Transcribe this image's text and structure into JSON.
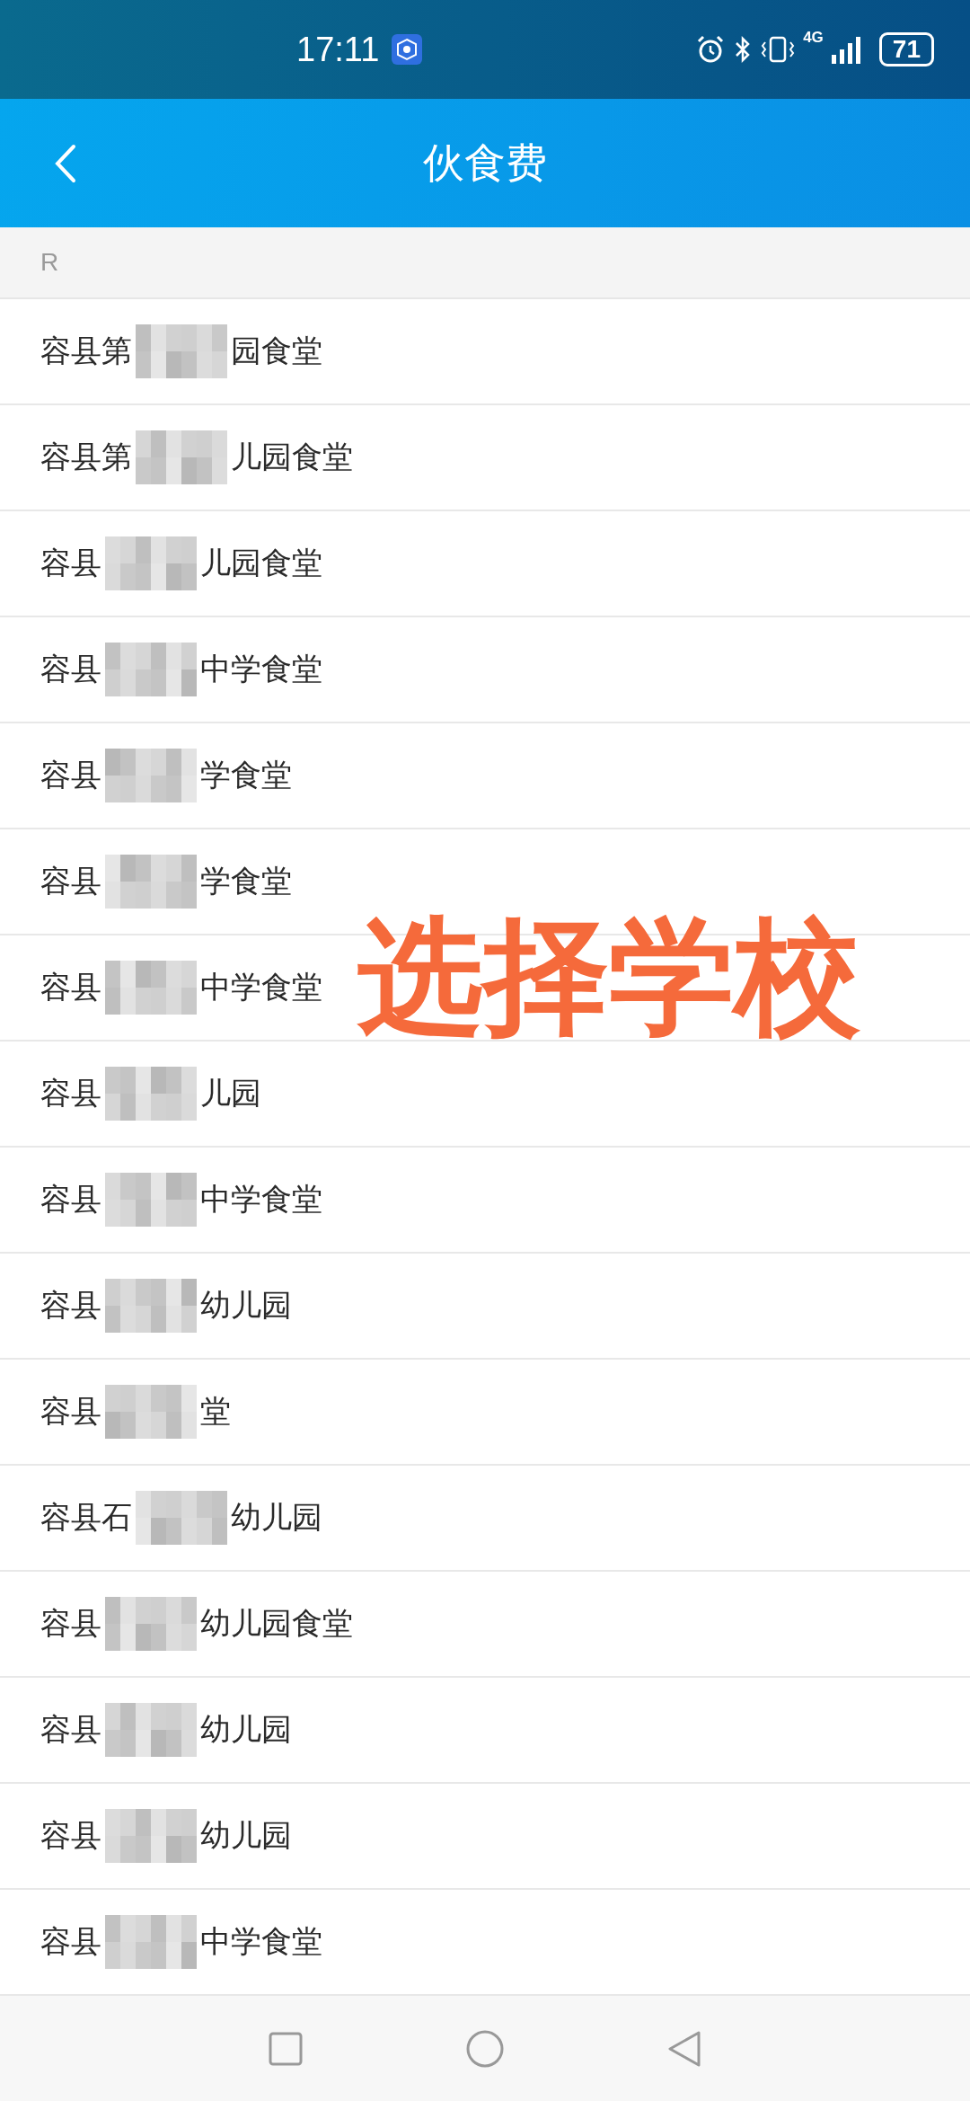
{
  "status_bar": {
    "time": "17:11",
    "network": "4G",
    "battery": "71"
  },
  "nav_bar": {
    "title": "伙食费"
  },
  "section_header": "R",
  "schools": [
    {
      "prefix": "容县第",
      "suffix": "园食堂"
    },
    {
      "prefix": "容县第",
      "suffix": "儿园食堂"
    },
    {
      "prefix": "容县",
      "suffix": "儿园食堂"
    },
    {
      "prefix": "容县",
      "suffix": "中学食堂"
    },
    {
      "prefix": "容县",
      "suffix": "学食堂"
    },
    {
      "prefix": "容县",
      "suffix": "学食堂"
    },
    {
      "prefix": "容县",
      "suffix": "中学食堂"
    },
    {
      "prefix": "容县",
      "suffix": "儿园"
    },
    {
      "prefix": "容县",
      "suffix": "中学食堂"
    },
    {
      "prefix": "容县",
      "suffix": "幼儿园"
    },
    {
      "prefix": "容县",
      "suffix": "堂"
    },
    {
      "prefix": "容县石",
      "suffix": "幼儿园"
    },
    {
      "prefix": "容县",
      "suffix": "幼儿园食堂"
    },
    {
      "prefix": "容县",
      "suffix": "幼儿园"
    },
    {
      "prefix": "容县",
      "suffix": "幼儿园"
    },
    {
      "prefix": "容县",
      "suffix": "中学食堂"
    }
  ],
  "annotation": "选择学校"
}
